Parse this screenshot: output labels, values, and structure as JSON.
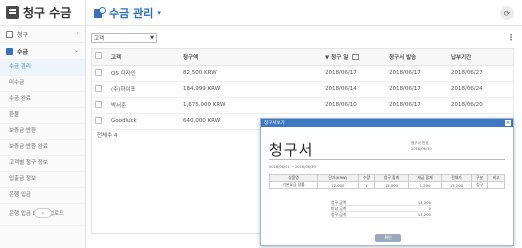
{
  "app": {
    "title": "청구 수금"
  },
  "sidebar": {
    "top_item": "청구",
    "group_label": "수금",
    "items": [
      {
        "label": "수금 관리",
        "active": true
      },
      {
        "label": "미수금"
      },
      {
        "label": "수금 완료"
      },
      {
        "label": "환불"
      },
      {
        "label": "보증금 반환"
      },
      {
        "label": "보증금 반환 완료"
      },
      {
        "label": "고객별 청구 정보"
      },
      {
        "label": "입출금 정보"
      },
      {
        "label": "은행 입금"
      },
      {
        "label": "은행 입금 Excel 업로드"
      }
    ]
  },
  "page": {
    "title": "수금 관리",
    "caret": "▾"
  },
  "filter": {
    "value": "고객"
  },
  "table": {
    "columns": [
      "고객",
      "청구액",
      "청구 일",
      "청구서 발송",
      "납부기간"
    ],
    "rows": [
      {
        "customer": "OS 디자인",
        "amount": "82,500 KRW",
        "billing_date": "2018/06/17",
        "sent": "2018/06/17",
        "due": "2018/06/27"
      },
      {
        "customer": "(주)하이포",
        "amount": "184,999 KRW",
        "billing_date": "2018/06/14",
        "sent": "2018/06/17",
        "due": "2018/06/24"
      },
      {
        "customer": "박서준",
        "amount": "1,675,000 KRW",
        "billing_date": "2018/06/10",
        "sent": "2018/06/17",
        "due": "2018/06/20"
      },
      {
        "customer": "Goodluck",
        "amount": "640,000 KRW",
        "billing_date": "2018/06/10",
        "sent": "2018/06/17",
        "due": "2018/06/20"
      }
    ],
    "total_label": "전체수 4"
  },
  "invoice": {
    "window_title": "청구서보기",
    "title": "청구서",
    "date_label": "2018/06/01 ~ 2018/06/30",
    "issuer_label": "청구서 번호",
    "issue_date": "2018/06/20",
    "table_headers": [
      "상품명",
      "단가(KRW)",
      "수량",
      "청구 합계",
      "세금 합계",
      "전체가",
      "구분",
      "비고"
    ],
    "table_row": [
      "기본요금 정률",
      "12,000",
      "1",
      "12,000",
      "1,200",
      "13,200",
      "청구",
      ""
    ],
    "summary": [
      {
        "label": "청구 금액",
        "value": "13,200"
      },
      {
        "label": "미납 금액",
        "value": "0"
      },
      {
        "label": "청구 금액",
        "value": "13,200"
      }
    ],
    "confirm_label": "확인"
  }
}
